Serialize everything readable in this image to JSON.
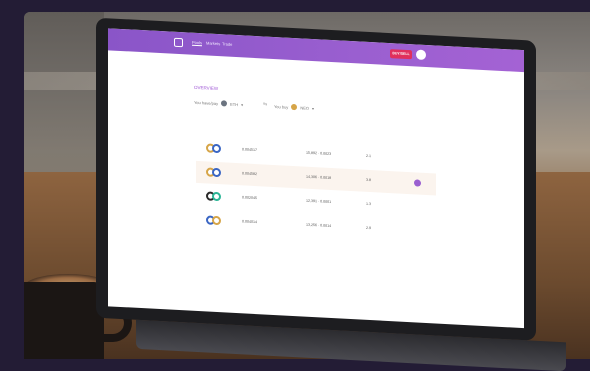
{
  "nav": {
    "links": [
      "Pools",
      "Markets",
      "Trade"
    ],
    "connect_label": "BUY/SELL"
  },
  "page": {
    "title": "OVERVIEW"
  },
  "filters": {
    "left_label": "You have/pay",
    "left_token": "ETH",
    "right_label": "You buy",
    "right_token": "NEO"
  },
  "columns": [
    "",
    "",
    "",
    ""
  ],
  "rows": [
    {
      "colors": [
        "#d6a548",
        "#3a66c4"
      ],
      "a": "0.004517",
      "b": "15,892 · 0.0023",
      "c": "2.1",
      "highlight": false
    },
    {
      "colors": [
        "#d6a548",
        "#3a66c4"
      ],
      "a": "0.004582",
      "b": "14,306 · 0.0018",
      "c": "3.8",
      "highlight": true
    },
    {
      "colors": [
        "#2a2a2a",
        "#2bb596"
      ],
      "a": "0.002045",
      "b": "12,391 · 0.0001",
      "c": "1.3",
      "highlight": false
    },
    {
      "colors": [
        "#3a66c4",
        "#d6a548"
      ],
      "a": "0.004014",
      "b": "13,256 · 0.0014",
      "c": "2.9",
      "highlight": false
    }
  ],
  "colors": {
    "accent": "#9a5fd0",
    "connect": "#e0305c"
  }
}
